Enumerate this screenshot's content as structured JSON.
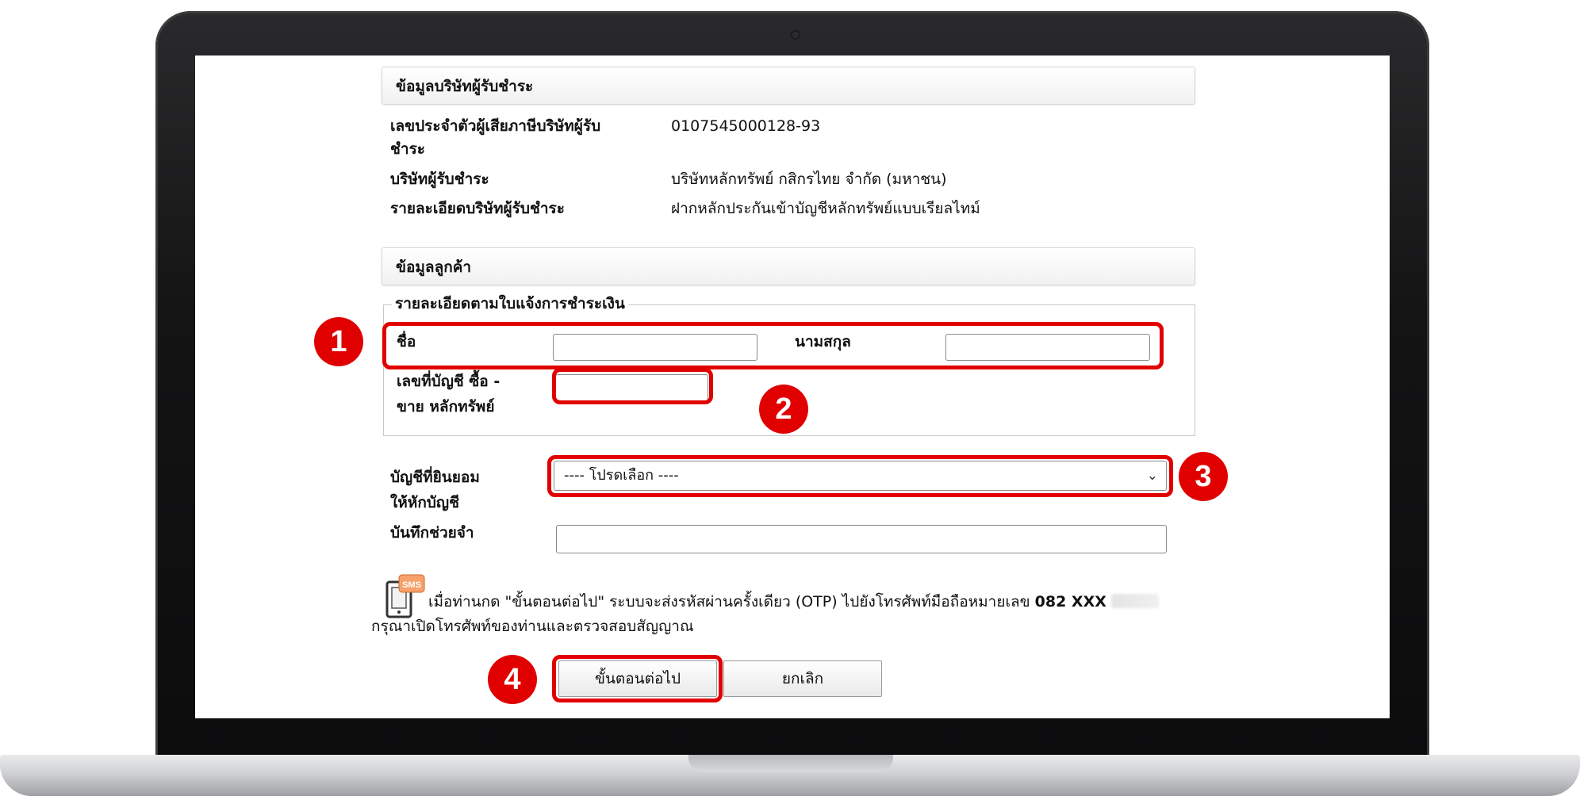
{
  "company_section": {
    "header": "ข้อมูลบริษัทผู้รับชำระ",
    "tax_id_label_line1": "เลขประจำตัวผู้เสียภาษีบริษัทผู้รับ",
    "tax_id_label_line2": "ชำระ",
    "tax_id_value": "0107545000128-93",
    "company_label": "บริษัทผู้รับชำระ",
    "company_value": "บริษัทหลักทรัพย์ กสิกรไทย จำกัด (มหาชน)",
    "detail_label": "รายละเอียดบริษัทผู้รับชำระ",
    "detail_value": "ฝากหลักประกันเข้าบัญชีหลักทรัพย์แบบเรียลไทม์"
  },
  "customer_section": {
    "header": "ข้อมูลลูกค้า",
    "legend": "รายละเอียดตามใบแจ้งการชำระเงิน",
    "first_name_label": "ชื่อ",
    "first_name_value": "",
    "last_name_label": "นามสกุล",
    "last_name_value": "",
    "account_label_line1": "เลขที่บัญชี ซื้อ -",
    "account_label_line2": "ขาย หลักทรัพย์",
    "account_value": "",
    "debit_account_label_line1": "บัญชีที่ยินยอม",
    "debit_account_label_line2": "ให้หักบัญชี",
    "debit_account_selected": "---- โปรดเลือก ----",
    "memo_label": "บันทึกช่วยจำ",
    "memo_value": ""
  },
  "otp_notice": {
    "icon": "sms-phone-icon",
    "icon_text": "SMS",
    "line1_prefix": "เมื่อท่านกด \"ขั้นตอนต่อไป\" ระบบจะส่งรหัสผ่านครั้งเดียว (OTP) ไปยังโทรศัพท์มือถือหมายเลข",
    "phone_visible": "082 XXX",
    "line2": "กรุณาเปิดโทรศัพท์ของท่านและตรวจสอบสัญญาณ"
  },
  "buttons": {
    "next_label": "ขั้นตอนต่อไป",
    "cancel_label": "ยกเลิก"
  },
  "step_badges": [
    "1",
    "2",
    "3",
    "4"
  ],
  "colors": {
    "highlight": "#e10000",
    "laptop_bezel": "#141415",
    "laptop_base": "#cfd1d4"
  }
}
